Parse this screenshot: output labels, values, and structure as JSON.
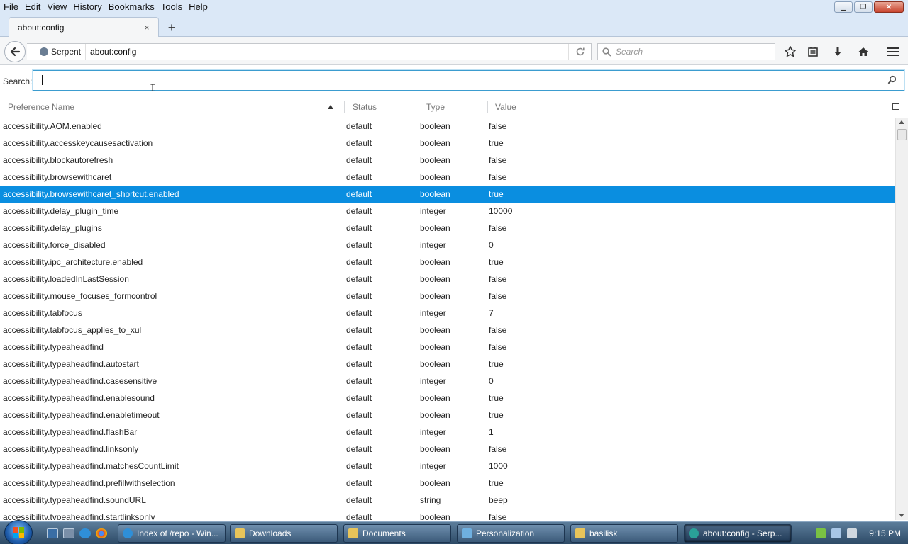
{
  "menubar": {
    "items": [
      {
        "label": "File"
      },
      {
        "label": "Edit"
      },
      {
        "label": "View"
      },
      {
        "label": "History"
      },
      {
        "label": "Bookmarks"
      },
      {
        "label": "Tools"
      },
      {
        "label": "Help"
      }
    ]
  },
  "tab": {
    "title": "about:config",
    "close_icon": "×",
    "newtab_icon": "+"
  },
  "navbar": {
    "identity_label": "Serpent",
    "url": "about:config",
    "search_placeholder": "Search"
  },
  "config_search": {
    "label": "Search:",
    "value": ""
  },
  "columns": {
    "name": "Preference Name",
    "status": "Status",
    "type": "Type",
    "value": "Value"
  },
  "rows": [
    {
      "name": "accessibility.AOM.enabled",
      "status": "default",
      "type": "boolean",
      "value": "false"
    },
    {
      "name": "accessibility.accesskeycausesactivation",
      "status": "default",
      "type": "boolean",
      "value": "true"
    },
    {
      "name": "accessibility.blockautorefresh",
      "status": "default",
      "type": "boolean",
      "value": "false"
    },
    {
      "name": "accessibility.browsewithcaret",
      "status": "default",
      "type": "boolean",
      "value": "false"
    },
    {
      "name": "accessibility.browsewithcaret_shortcut.enabled",
      "status": "default",
      "type": "boolean",
      "value": "true",
      "selected": true
    },
    {
      "name": "accessibility.delay_plugin_time",
      "status": "default",
      "type": "integer",
      "value": "10000"
    },
    {
      "name": "accessibility.delay_plugins",
      "status": "default",
      "type": "boolean",
      "value": "false"
    },
    {
      "name": "accessibility.force_disabled",
      "status": "default",
      "type": "integer",
      "value": "0"
    },
    {
      "name": "accessibility.ipc_architecture.enabled",
      "status": "default",
      "type": "boolean",
      "value": "true"
    },
    {
      "name": "accessibility.loadedInLastSession",
      "status": "default",
      "type": "boolean",
      "value": "false"
    },
    {
      "name": "accessibility.mouse_focuses_formcontrol",
      "status": "default",
      "type": "boolean",
      "value": "false"
    },
    {
      "name": "accessibility.tabfocus",
      "status": "default",
      "type": "integer",
      "value": "7"
    },
    {
      "name": "accessibility.tabfocus_applies_to_xul",
      "status": "default",
      "type": "boolean",
      "value": "false"
    },
    {
      "name": "accessibility.typeaheadfind",
      "status": "default",
      "type": "boolean",
      "value": "false"
    },
    {
      "name": "accessibility.typeaheadfind.autostart",
      "status": "default",
      "type": "boolean",
      "value": "true"
    },
    {
      "name": "accessibility.typeaheadfind.casesensitive",
      "status": "default",
      "type": "integer",
      "value": "0"
    },
    {
      "name": "accessibility.typeaheadfind.enablesound",
      "status": "default",
      "type": "boolean",
      "value": "true"
    },
    {
      "name": "accessibility.typeaheadfind.enabletimeout",
      "status": "default",
      "type": "boolean",
      "value": "true"
    },
    {
      "name": "accessibility.typeaheadfind.flashBar",
      "status": "default",
      "type": "integer",
      "value": "1"
    },
    {
      "name": "accessibility.typeaheadfind.linksonly",
      "status": "default",
      "type": "boolean",
      "value": "false"
    },
    {
      "name": "accessibility.typeaheadfind.matchesCountLimit",
      "status": "default",
      "type": "integer",
      "value": "1000"
    },
    {
      "name": "accessibility.typeaheadfind.prefillwithselection",
      "status": "default",
      "type": "boolean",
      "value": "true"
    },
    {
      "name": "accessibility.typeaheadfind.soundURL",
      "status": "default",
      "type": "string",
      "value": "beep"
    },
    {
      "name": "accessibility.typeaheadfind.startlinksonly",
      "status": "default",
      "type": "boolean",
      "value": "false"
    }
  ],
  "taskbar": {
    "buttons": [
      {
        "label": "Index of /repo - Win...",
        "icon": "ie-icon"
      },
      {
        "label": "Downloads",
        "icon": "folder-icon"
      },
      {
        "label": "Documents",
        "icon": "folder-icon"
      },
      {
        "label": "Personalization",
        "icon": "control-panel-icon"
      },
      {
        "label": "basilisk",
        "icon": "folder-icon"
      },
      {
        "label": "about:config - Serp...",
        "icon": "serpent-browser-icon"
      }
    ],
    "clock": "9:15 PM"
  },
  "colors": {
    "selection": "#0a8ee0",
    "chrome": "#dbe8f7",
    "taskbar": "#2d4a66"
  }
}
